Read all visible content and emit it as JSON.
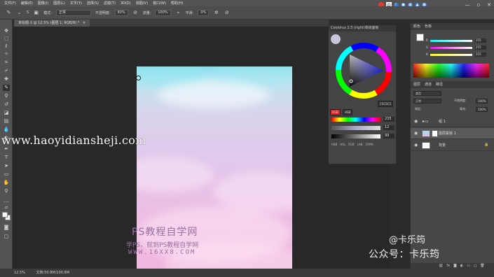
{
  "menubar": {
    "items": [
      "文件(F)",
      "编辑(E)",
      "图像(I)",
      "图层(L)",
      "文字(Y)",
      "选择(S)",
      "滤镜(T)",
      "3D(D)",
      "视图(V)",
      "窗口(W)",
      "帮助(H)"
    ]
  },
  "system_tray": {
    "ime_label": "中",
    "items": [
      "ime-icon",
      "moon-icon",
      "mic-icon",
      "keyboard-icon",
      "shirt-icon",
      "grid-icon"
    ]
  },
  "window_controls": {
    "minimize": "—",
    "restore": "▫",
    "close": "✕"
  },
  "options": {
    "brush_size": "5",
    "mode_label": "模式:",
    "mode_value": "正常",
    "opacity_label": "不透明度:",
    "opacity_value": "80%",
    "flow_label": "流量:",
    "flow_value": "100%",
    "smooth_label": "平滑:",
    "smooth_value": "0%"
  },
  "document": {
    "tab_title": "未标题-1 @ 12.5% (图层 1, RGB/8) *"
  },
  "color_wheel_panel": {
    "title": "Coolorus 2.5 (right)高级面板",
    "hex_value": "C5C5C5",
    "mode_button": "RGB",
    "sliders": [
      {
        "value": "235",
        "color": "#ff3a3a"
      },
      {
        "value": "12",
        "color": "#4ac8ff"
      },
      {
        "value": "99",
        "color": "#888888"
      }
    ],
    "tabs": [
      "HSB",
      "HSL",
      "RGB",
      "LAB",
      "CMYK"
    ]
  },
  "color_panel": {
    "tabs": [
      "颜色",
      "色板"
    ],
    "rgb_values": [
      "255",
      "255",
      "255"
    ],
    "rgb_labels": [
      "R",
      "G",
      "B"
    ]
  },
  "layers_panel": {
    "tabs": [
      "图层",
      "通道",
      "路径"
    ],
    "filter_label": "类型",
    "blend_mode": "正常",
    "opacity_label": "不透明度:",
    "opacity_value": "100%",
    "lock_label": "锁定:",
    "fill_label": "填充:",
    "fill_value": "100%",
    "layers": [
      {
        "name": "组 1",
        "type": "group"
      },
      {
        "name": "图层蒙版 1",
        "type": "mask"
      },
      {
        "name": "背景",
        "type": "background"
      }
    ]
  },
  "statusbar": {
    "zoom": "12.5%",
    "doc_info": "文档:50.8M/100.9M"
  },
  "watermarks": {
    "url": "www.haoyidianshejі.com",
    "ps_title": "PS教程自学网",
    "ps_subtitle": "学PS，就到PS教程自学网",
    "ps_site": "WWW.16XX8.COM",
    "at_name": "@卡乐筠",
    "public_account": "公众号：卡乐筠"
  }
}
